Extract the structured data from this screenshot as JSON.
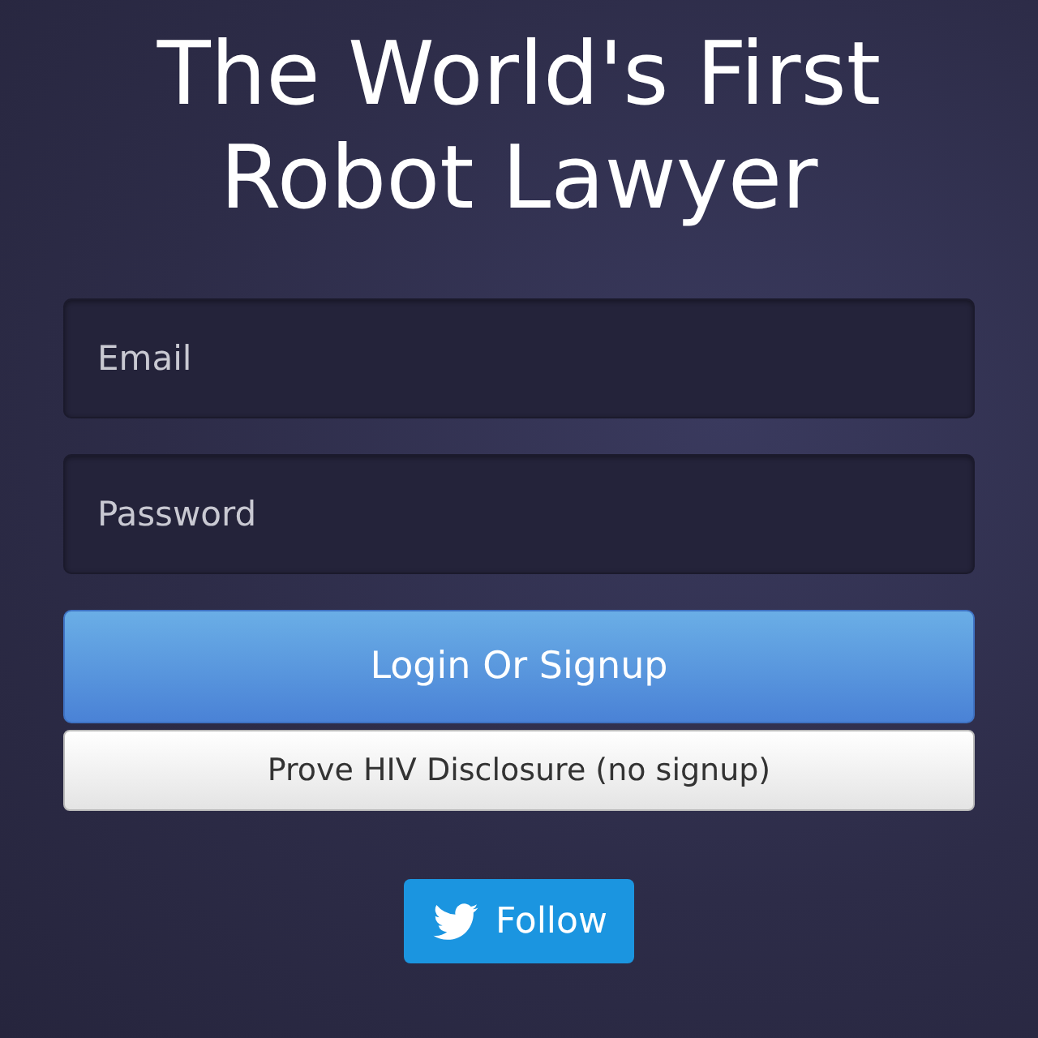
{
  "title": "The World's First Robot Lawyer",
  "fields": [
    {
      "placeholder": "Email"
    },
    {
      "placeholder": "Password"
    }
  ],
  "buttons": [
    {
      "label": "Login Or Signup",
      "kind": "primary"
    },
    {
      "label": "Prove HIV Disclosure (no signup)",
      "kind": "secondary"
    }
  ],
  "follow_button": {
    "label": "Follow"
  }
}
